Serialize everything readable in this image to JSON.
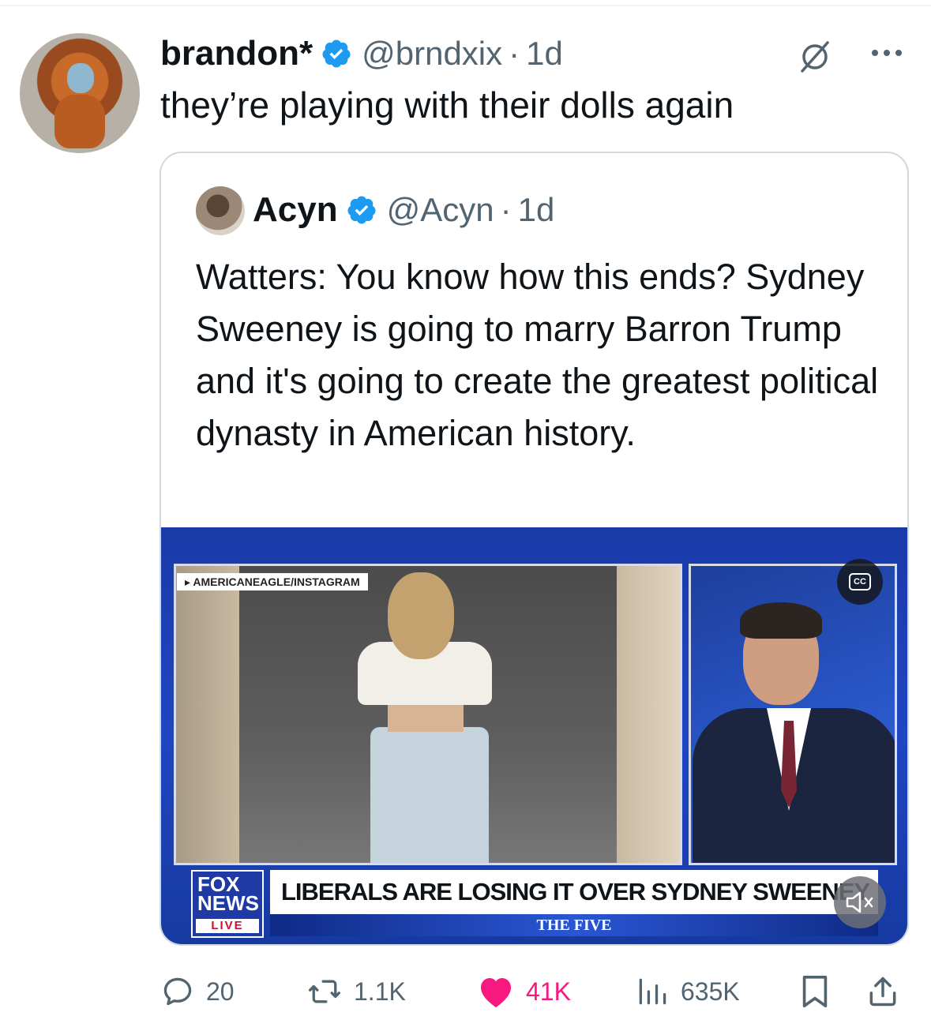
{
  "tweet": {
    "author_name": "brandon*",
    "author_handle": "@brndxix",
    "separator": "·",
    "time": "1d",
    "text": "they’re playing with their dolls again",
    "avatar_icon": "monkey-avatar",
    "verified_icon": "verified-badge-icon"
  },
  "quote": {
    "author_name": "Acyn",
    "author_handle": "@Acyn",
    "separator": "·",
    "time": "1d",
    "text": "Watters: You know how this ends? Sydney Sweeney is going to marry Barron Trump and it's going to create the greatest political dynasty in American history.",
    "media": {
      "source_tag": "▸ AMERICANEAGLE/INSTAGRAM",
      "logo_line1": "FOX",
      "logo_line2": "NEWS",
      "logo_live": "LIVE",
      "chyron": "LIBERALS ARE LOSING IT OVER SYDNEY SWEENEY",
      "show_name": "THE FIVE",
      "cc_label": "CC"
    }
  },
  "actions": {
    "replies": "20",
    "reposts": "1.1K",
    "likes": "41K",
    "views": "635K",
    "liked": true
  },
  "colors": {
    "text_primary": "#0f1419",
    "text_secondary": "#536471",
    "verified": "#1d9bf0",
    "like": "#f91880",
    "border": "#cfd9de"
  }
}
